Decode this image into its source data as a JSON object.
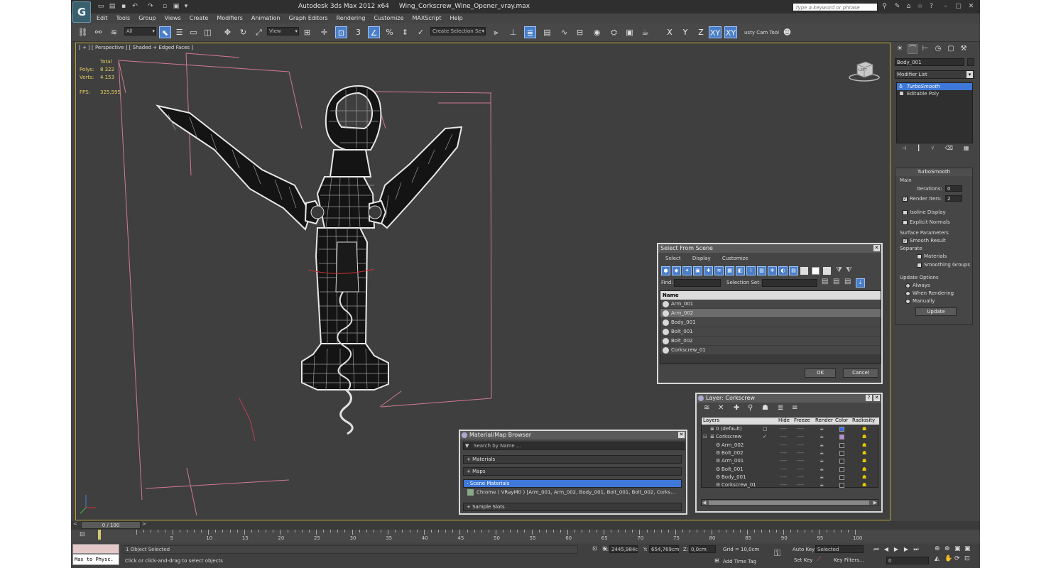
{
  "app": {
    "logo": "G",
    "name": "Autodesk 3ds Max  2012 x64",
    "file": "Wing_Corkscrew_Wine_Opener_vray.max",
    "search_placeholder": "Type a keyword or phrase"
  },
  "menu": [
    "Edit",
    "Tools",
    "Group",
    "Views",
    "Create",
    "Modifiers",
    "Animation",
    "Graph Editors",
    "Rendering",
    "Customize",
    "MAXScript",
    "Help"
  ],
  "toolbar": {
    "filter_value": "All",
    "refcoord_value": "View",
    "selection_set_placeholder": "Create Selection Se",
    "axis": [
      "X",
      "Y",
      "Z",
      "XY",
      "XY"
    ],
    "snap_value": "3",
    "cam_tool": "usty Cam Tool"
  },
  "viewport": {
    "label": "[ + ] [ Perspective ] [ Shaded + Edged Faces ]",
    "stats_header": "Total",
    "polys_label": "Polys:",
    "polys_value": "8 322",
    "verts_label": "Verts:",
    "verts_value": "4 153",
    "fps_label": "FPS:",
    "fps_value": "325,595",
    "viewcube_label": "LEFT"
  },
  "command_panel": {
    "object_name": "Body_001",
    "modifier_list": "Modifier List",
    "stack": [
      "TurboSmooth",
      "Editable Poly"
    ],
    "turbosmooth": {
      "title": "TurboSmooth",
      "main": "Main",
      "iterations_label": "Iterations:",
      "iterations_value": "0",
      "render_iters_label": "Render Iters:",
      "render_iters_value": "2",
      "isoline": "Isoline Display",
      "explicit": "Explicit Normals",
      "surface_params": "Surface Parameters",
      "smooth_result": "Smooth Result",
      "separate": "Separate",
      "materials": "Materials",
      "smoothing_groups": "Smoothing Groups",
      "update_options": "Update Options",
      "always": "Always",
      "when_rendering": "When Rendering",
      "manually": "Manually",
      "update": "Update"
    }
  },
  "select_dialog": {
    "title": "Select From Scene",
    "menu": [
      "Select",
      "Display",
      "Customize"
    ],
    "find_label": "Find:",
    "selection_set_label": "Selection Set:",
    "column_name": "Name",
    "items": [
      "Arm_001",
      "Arm_002",
      "Body_001",
      "Bolt_001",
      "Bolt_002",
      "Corkscrew_01"
    ],
    "ok": "OK",
    "cancel": "Cancel"
  },
  "layer_dialog": {
    "title": "Layer: Corkscrew",
    "columns": [
      "Layers",
      "Hide",
      "Freeze",
      "Render",
      "Color",
      "Radiosity"
    ],
    "rows": [
      {
        "name": "0 (default)",
        "indent": 1
      },
      {
        "name": "Corkscrew",
        "indent": 0
      },
      {
        "name": "Arm_002",
        "indent": 2
      },
      {
        "name": "Bolt_002",
        "indent": 2
      },
      {
        "name": "Arm_001",
        "indent": 2
      },
      {
        "name": "Bolt_001",
        "indent": 2
      },
      {
        "name": "Body_001",
        "indent": 2
      },
      {
        "name": "Corkscrew_01",
        "indent": 2
      }
    ]
  },
  "material_browser": {
    "title": "Material/Map Browser",
    "search_placeholder": "Search by Name ...",
    "materials": "+ Materials",
    "maps": "+ Maps",
    "scene_materials": "- Scene Materials",
    "chrome_row": "Chrome  ( VRayMtl )  [Arm_001, Arm_002, Body_001, Bolt_001, Bolt_002, Corks...",
    "sample_slots": "+ Sample Slots"
  },
  "timeline": {
    "frame": "0 / 100",
    "ticks": [
      "0",
      "5",
      "10",
      "15",
      "20",
      "25",
      "30",
      "35",
      "40",
      "45",
      "50",
      "55",
      "60",
      "65",
      "70",
      "75",
      "80",
      "85",
      "90",
      "95",
      "100"
    ]
  },
  "status": {
    "script_listener": "Max to Physc.",
    "selected": "1 Object Selected",
    "prompt": "Click or click-and-drag to select objects",
    "x_label": "X:",
    "x_value": "2445,984c",
    "y_label": "Y:",
    "y_value": "654,769cm",
    "z_label": "Z:",
    "z_value": "0,0cm",
    "grid": "Grid = 10,0cm",
    "add_time_tag": "Add Time Tag",
    "auto_key": "Auto Key",
    "set_key": "Set Key",
    "key_mode": "Selected",
    "key_filters": "Key Filters...",
    "frame_value": "0"
  }
}
